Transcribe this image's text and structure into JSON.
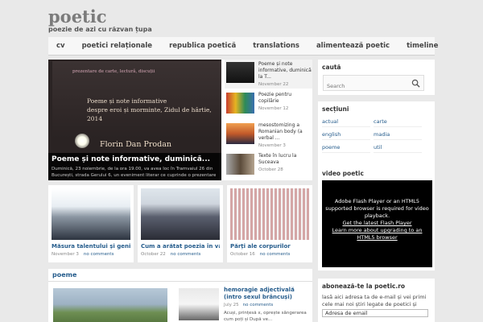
{
  "site": {
    "title": "poetic",
    "description": "poezie de azi cu răzvan țupa"
  },
  "nav": {
    "items": [
      "cv",
      "poetici relaționale",
      "republica poetică",
      "translations",
      "alimentează poetic",
      "timeline"
    ]
  },
  "featured": {
    "slide_line1": "prezentare de carte, lectură, discuții",
    "slide_board_lines": [
      "Poeme și note informative",
      "despre eroi și morminte, Zidul de hârtie,",
      "2014"
    ],
    "slide_author": "Florin Dan Prodan",
    "title": "Poeme și note informative, duminică...",
    "excerpt": "Duminică, 23 noiembrie, de la ora 19.00, va avea loc în Tramvaiul 26 din București, strada Gerului 6, un eveniment literar ce cuprinde o prezentare"
  },
  "side_posts": [
    {
      "title": "Poeme și note informative, duminică la T...",
      "date": "November 22"
    },
    {
      "title": "Poezie pentru copilărie",
      "date": "November 12"
    },
    {
      "title": "mesostomizing a Romanian body (a verbal ...",
      "date": "November 3"
    },
    {
      "title": "Texte în lucru la Suceava",
      "date": "October 28"
    }
  ],
  "cards": [
    {
      "title": "Măsura talentului și geni...",
      "date": "November 3",
      "comments": "no comments"
    },
    {
      "title": "Cum a arătat poezia în va...",
      "date": "October 22",
      "comments": "no comments"
    },
    {
      "title": "Părți ale corpurilor",
      "date": "October 16",
      "comments": "no comments"
    }
  ],
  "poeme": {
    "heading": "poeme",
    "post": {
      "title": "hemoragie adjectivală (intro sexul brâncuși)",
      "date": "July 25",
      "comments": "no comments",
      "excerpt": "Acuși, prințesă x, oprește sângerarea cum poți și După ve..."
    }
  },
  "sidebar": {
    "search": {
      "title": "caută",
      "placeholder": "Search"
    },
    "sections": {
      "title": "secțiuni",
      "items": [
        "actual",
        "carte",
        "english",
        "madia",
        "poeme",
        "util"
      ]
    },
    "video": {
      "title": "video poetic",
      "message": "Adobe Flash Player or an HTML5 supported browser is required for video playback.",
      "link1": "Get the latest Flash Player",
      "link2": "Learn more about upgrading to an HTML5 browser"
    },
    "subscribe": {
      "title": "abonează-te la poetic.ro",
      "text": "lasă aici adresa ta de e-mail și vei primi cele mai noi știri legate de poetici și poezie",
      "input_value": "Adresa de email"
    }
  },
  "colors": {
    "link": "#255c8c",
    "background": "#e9e9e9"
  }
}
